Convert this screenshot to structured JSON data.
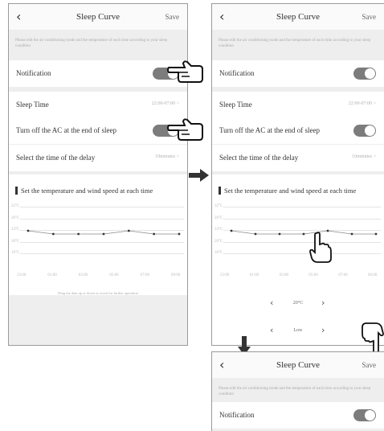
{
  "screen": {
    "title": "Sleep Curve",
    "save_label": "Save",
    "description": "Please edit the air conditioning mode and the temperature of each time according to your sleep condition",
    "rows": {
      "notification": {
        "label": "Notification",
        "enabled": true
      },
      "sleep_time": {
        "label": "Sleep Time",
        "value": "22:00-07:00 >"
      },
      "turn_off": {
        "label": "Turn off the AC at the end of sleep",
        "enabled": true
      },
      "delay": {
        "label": "Select the time of the delay",
        "value": "10minutes >"
      }
    },
    "section_title": "Set the temperature and wind speed at each time",
    "hint": "Drag the data up or down or touch for further operation",
    "temperature_selector": {
      "value": "20°C"
    },
    "wind_selector": {
      "value": "Low"
    }
  },
  "chart_data": {
    "type": "line",
    "y_ticks": [
      "32°C",
      "26°C",
      "24°C",
      "20°C",
      "16°C"
    ],
    "x": [
      "23:00",
      "01:00",
      "03:00",
      "05:00",
      "07:00",
      "09:00"
    ],
    "values": [
      26,
      25,
      25,
      25,
      26,
      25,
      25
    ],
    "ylim": [
      16,
      32
    ]
  },
  "ui_icons": {
    "back": "chevron-left-icon",
    "right_arrow": "arrow-right-icon",
    "down_arrow": "arrow-down-icon",
    "hand": "pointing-hand-icon"
  },
  "colors": {
    "toggle_on": "#7c7c7c",
    "background": "#eeeeef",
    "row_background": "#ffffff"
  }
}
